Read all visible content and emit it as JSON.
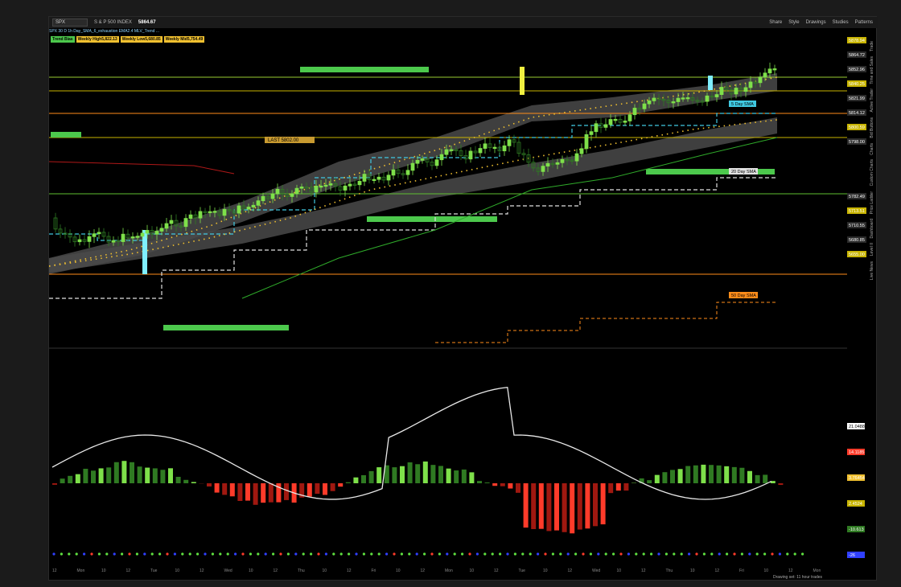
{
  "toolbar": {
    "symbol": "SPX",
    "quote_name": "S & P 500 INDEX",
    "price": "5864.67",
    "buttons": [
      "Share",
      "Style",
      "Drawings",
      "Studies",
      "Patterns"
    ]
  },
  "study_line": "SPX 30 D 1h   Day_SMA_6_exhaustion   EMA2.4   MLV_Trend ...",
  "badges": [
    "Trend Bias",
    "Weekly High5,822.13",
    "Weekly Low5,680.85",
    "Weekly Mid5,754.49"
  ],
  "price_tags": [
    "5878.94",
    "5864.72",
    "5852.96",
    "5840.25",
    "5821.99",
    "5814.12",
    "5800.59",
    "5798.00",
    "5782.49",
    "5713.51",
    "5710.55",
    "5680.85",
    "5655.00"
  ],
  "chart_labels": {
    "last": "LAST 5802.00",
    "sma5": "5 Day SMA",
    "sma20": "20 Day SMA",
    "sma50": "50 Day SMA"
  },
  "osc_tags": [
    "21.0488",
    "14.1185",
    "3.76454",
    "2.4524",
    "-10.613",
    "-26"
  ],
  "time_labels": [
    "12",
    "Mon",
    "10",
    "12",
    "Tue",
    "10",
    "12",
    "Wed",
    "10",
    "12",
    "Thu",
    "10",
    "12",
    "Fri",
    "10",
    "12",
    "Mon",
    "10",
    "12",
    "Tue",
    "10",
    "12",
    "Wed",
    "10",
    "12",
    "Thu",
    "10",
    "12",
    "Fri",
    "10",
    "12",
    "Mon"
  ],
  "right_tabs": [
    "Trade",
    "Time and Sales",
    "Active Trader",
    "Bid Buttons",
    "Charts",
    "Custom Charts",
    "Price Ladder",
    "Dashboard",
    "Level II",
    "Live News"
  ],
  "status": "Drawing set: 11 hour trades",
  "colors": {
    "up": "#7ee04a",
    "down": "#ff3b2a",
    "ribbon": "#4a4a4a"
  }
}
